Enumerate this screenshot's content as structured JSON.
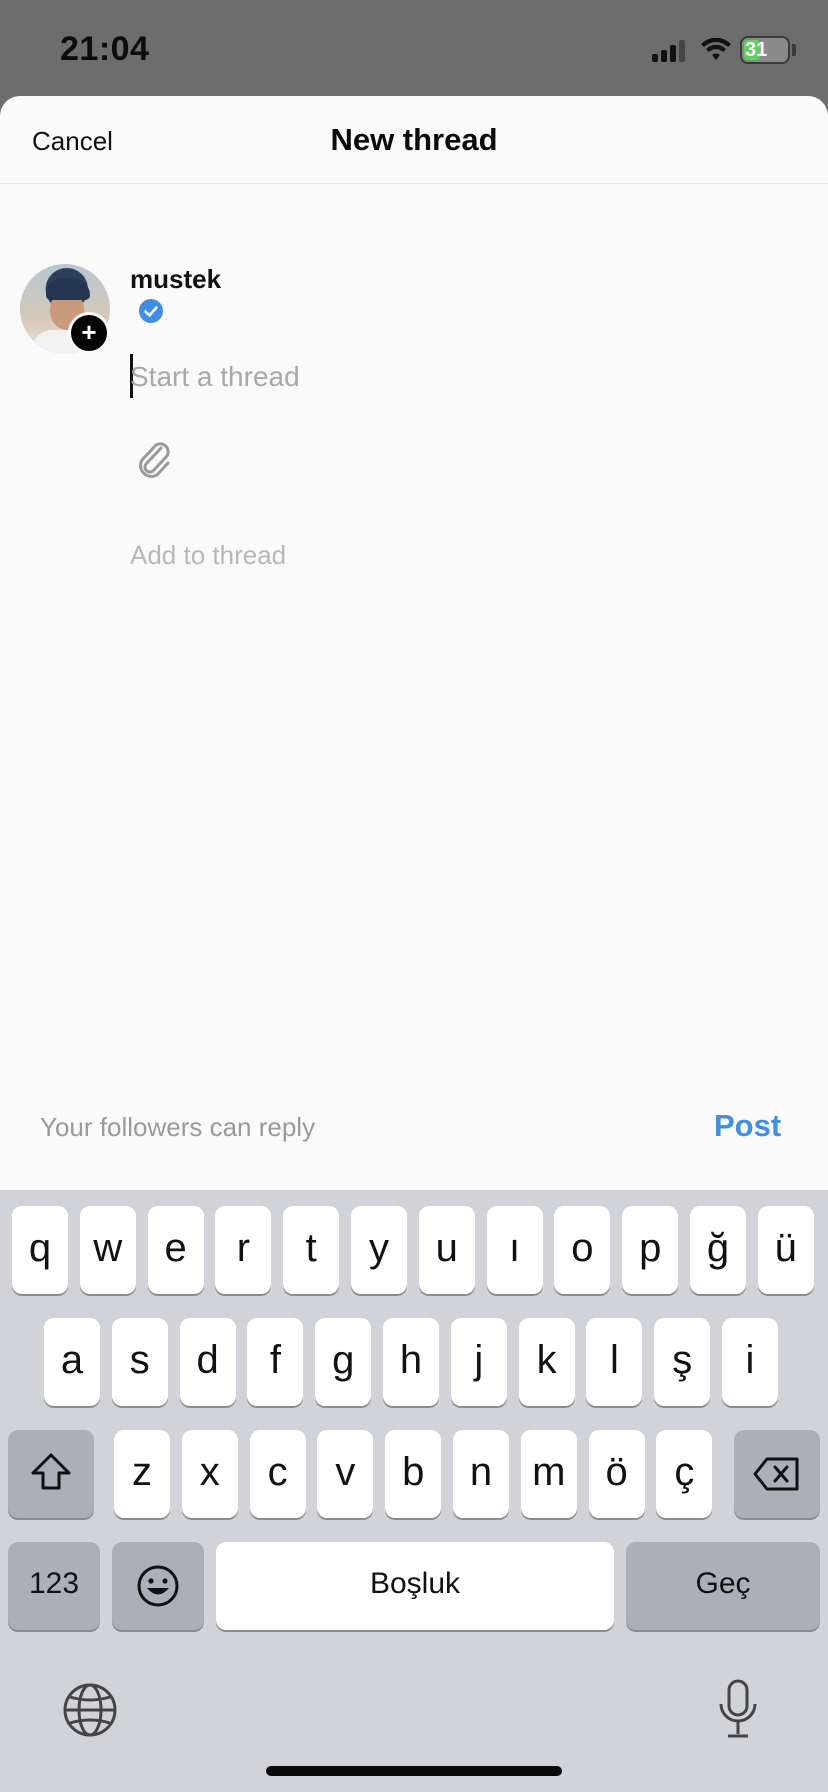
{
  "status_bar": {
    "time": "21:04",
    "battery_text": "31"
  },
  "header": {
    "title": "New thread",
    "cancel_label": "Cancel"
  },
  "composer": {
    "username": "mustek",
    "placeholder": "Start a thread",
    "value": "",
    "add_to_thread": "Add to thread",
    "verified": true
  },
  "footer": {
    "reply_setting": "Your followers can reply",
    "post_label": "Post",
    "accent_color": "#3f8ee3"
  },
  "keyboard": {
    "row1": [
      "q",
      "w",
      "e",
      "r",
      "t",
      "y",
      "u",
      "ı",
      "o",
      "p",
      "ğ",
      "ü"
    ],
    "row2": [
      "a",
      "s",
      "d",
      "f",
      "g",
      "h",
      "j",
      "k",
      "l",
      "ş",
      "i"
    ],
    "row3": [
      "z",
      "x",
      "c",
      "v",
      "b",
      "n",
      "m",
      "ö",
      "ç"
    ],
    "numbers_label": "123",
    "space_label": "Boşluk",
    "return_label": "Geç"
  }
}
